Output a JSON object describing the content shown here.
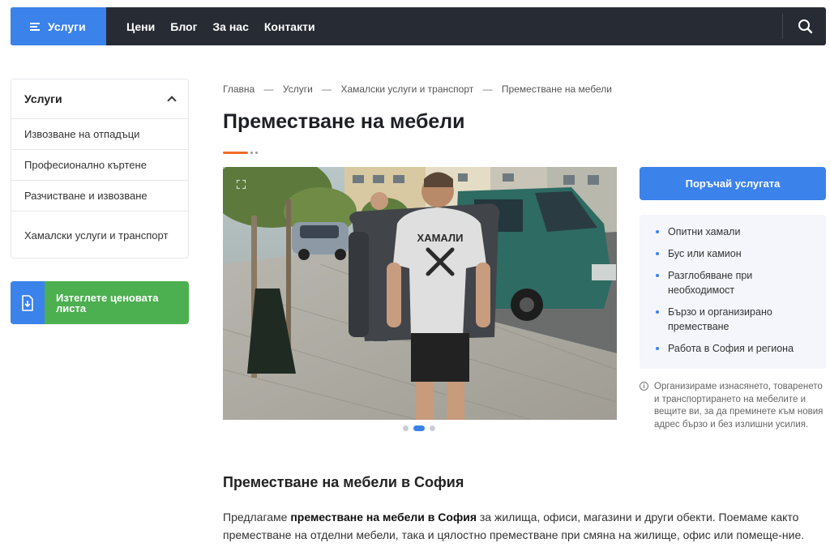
{
  "header": {
    "services_label": "Услуги",
    "nav": [
      "Цени",
      "Блог",
      "За нас",
      "Контакти"
    ]
  },
  "sidebar": {
    "title": "Услуги",
    "items": [
      "Извозване на отпадъци",
      "Професионално къртене",
      "Разчистване и извозване",
      "Хамалски услуги и транспорт"
    ],
    "download_label": "Изтеглете ценовата листа"
  },
  "breadcrumb": [
    "Главна",
    "Услуги",
    "Хамалски услуги и транспорт",
    "Преместване на мебели"
  ],
  "breadcrumb_separator": "—",
  "page_title": "Преместване на мебели",
  "gallery": {
    "slide_count": 3,
    "active_slide": 2,
    "shirt_text": "ХАМАЛИ"
  },
  "order_button": "Поръчай услугата",
  "features": [
    "Опитни хамали",
    "Бус или камион",
    "Разглобяване при необходимост",
    "Бързо и организирано преместване",
    "Работа в София и региона"
  ],
  "note": "Организираме изнасянето, товаренето и транспортирането на мебелите и вещите ви, за да преминете към новия адрес бързо и без излишни усилия.",
  "section": {
    "title": "Преместване на мебели в София",
    "para_pre": "Предлагаме ",
    "para_bold": "преместване на мебели в София",
    "para_post": " за жилища, офиси, магазини и други обекти. Поемаме както преместване на отделни мебели, така и цялостно преместване при смяна на жилище, офис или помеще-ние."
  },
  "colors": {
    "accent": "#3b82ea",
    "green": "#4caf50",
    "orange": "#f26b2a",
    "nav_bg": "#272b33"
  }
}
